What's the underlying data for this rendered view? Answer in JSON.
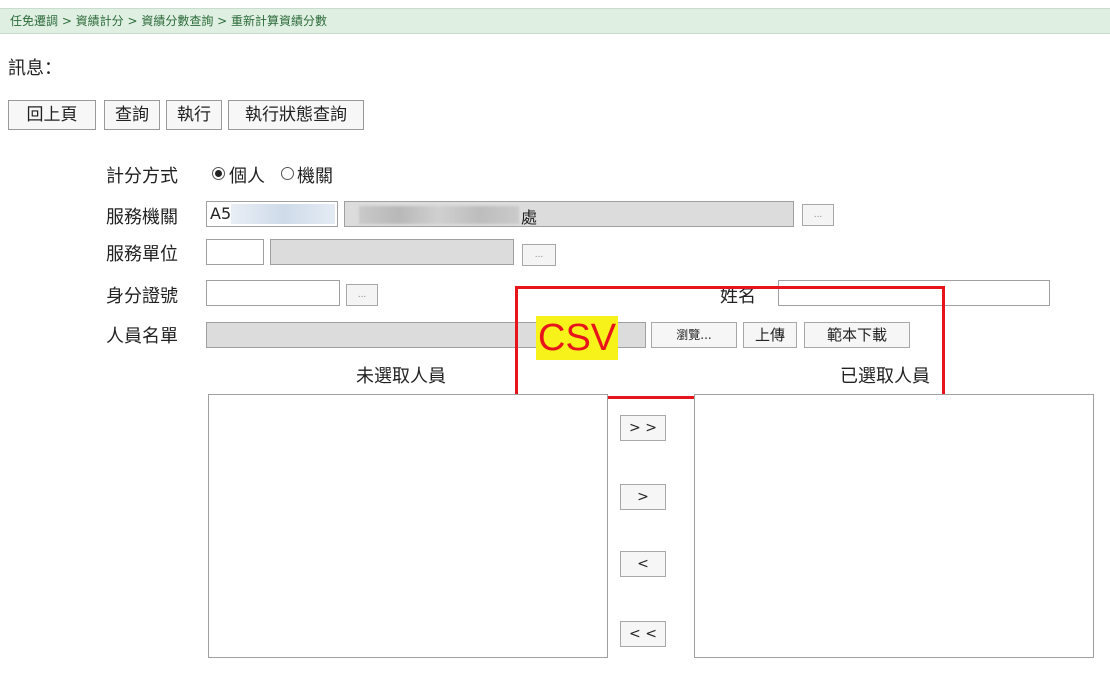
{
  "breadcrumb": "任免遷調 > 資績計分 > 資績分數查詢 > 重新計算資績分數",
  "message_label": "訊息：",
  "toolbar": {
    "back": "回上頁",
    "query": "查詢",
    "execute": "執行",
    "status_query": "執行狀態查詢"
  },
  "form": {
    "scoring_label": "計分方式",
    "scoring_options": [
      "個人",
      "機關"
    ],
    "scoring_selected": "個人",
    "agency_label": "服務機關",
    "agency_code": "A5",
    "agency_name_suffix": "處",
    "unit_label": "服務單位",
    "id_label": "身分證號",
    "name_label": "姓名",
    "roster_label": "人員名單",
    "ellipsis": "..."
  },
  "upload": {
    "csv_tag": "CSV",
    "browse": "瀏覽...",
    "upload": "上傳",
    "template_download": "範本下載"
  },
  "lists": {
    "unselected_title": "未選取人員",
    "selected_title": "已選取人員",
    "move_all_right": "> >",
    "move_right": ">",
    "move_left": "<",
    "move_all_left": "< <"
  },
  "colors": {
    "breadcrumb_bg": "#dff0e3",
    "highlight_box": "#e8141b",
    "csv_highlight": "#f6f21a",
    "csv_text": "#e8141b"
  }
}
